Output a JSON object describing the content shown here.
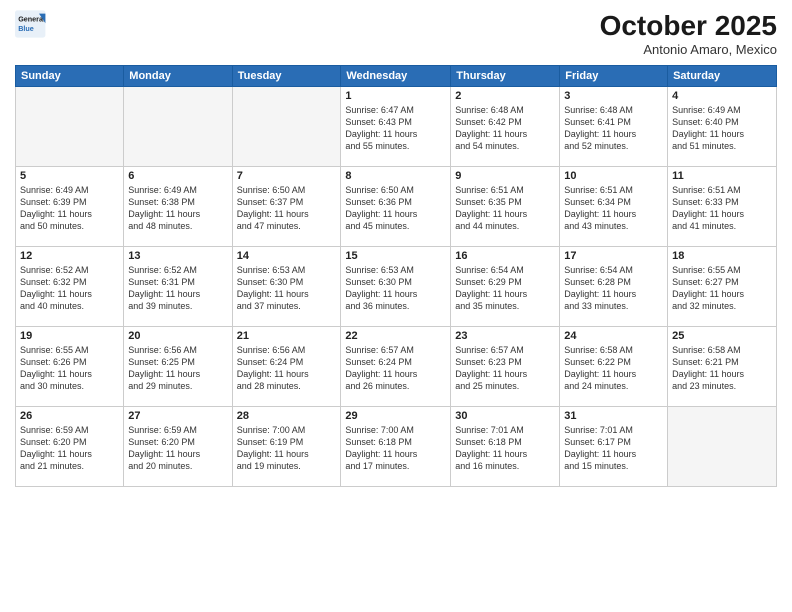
{
  "logo": {
    "line1": "General",
    "line2": "Blue"
  },
  "title": "October 2025",
  "subtitle": "Antonio Amaro, Mexico",
  "days_of_week": [
    "Sunday",
    "Monday",
    "Tuesday",
    "Wednesday",
    "Thursday",
    "Friday",
    "Saturday"
  ],
  "weeks": [
    [
      {
        "day": "",
        "text": ""
      },
      {
        "day": "",
        "text": ""
      },
      {
        "day": "",
        "text": ""
      },
      {
        "day": "1",
        "text": "Sunrise: 6:47 AM\nSunset: 6:43 PM\nDaylight: 11 hours\nand 55 minutes."
      },
      {
        "day": "2",
        "text": "Sunrise: 6:48 AM\nSunset: 6:42 PM\nDaylight: 11 hours\nand 54 minutes."
      },
      {
        "day": "3",
        "text": "Sunrise: 6:48 AM\nSunset: 6:41 PM\nDaylight: 11 hours\nand 52 minutes."
      },
      {
        "day": "4",
        "text": "Sunrise: 6:49 AM\nSunset: 6:40 PM\nDaylight: 11 hours\nand 51 minutes."
      }
    ],
    [
      {
        "day": "5",
        "text": "Sunrise: 6:49 AM\nSunset: 6:39 PM\nDaylight: 11 hours\nand 50 minutes."
      },
      {
        "day": "6",
        "text": "Sunrise: 6:49 AM\nSunset: 6:38 PM\nDaylight: 11 hours\nand 48 minutes."
      },
      {
        "day": "7",
        "text": "Sunrise: 6:50 AM\nSunset: 6:37 PM\nDaylight: 11 hours\nand 47 minutes."
      },
      {
        "day": "8",
        "text": "Sunrise: 6:50 AM\nSunset: 6:36 PM\nDaylight: 11 hours\nand 45 minutes."
      },
      {
        "day": "9",
        "text": "Sunrise: 6:51 AM\nSunset: 6:35 PM\nDaylight: 11 hours\nand 44 minutes."
      },
      {
        "day": "10",
        "text": "Sunrise: 6:51 AM\nSunset: 6:34 PM\nDaylight: 11 hours\nand 43 minutes."
      },
      {
        "day": "11",
        "text": "Sunrise: 6:51 AM\nSunset: 6:33 PM\nDaylight: 11 hours\nand 41 minutes."
      }
    ],
    [
      {
        "day": "12",
        "text": "Sunrise: 6:52 AM\nSunset: 6:32 PM\nDaylight: 11 hours\nand 40 minutes."
      },
      {
        "day": "13",
        "text": "Sunrise: 6:52 AM\nSunset: 6:31 PM\nDaylight: 11 hours\nand 39 minutes."
      },
      {
        "day": "14",
        "text": "Sunrise: 6:53 AM\nSunset: 6:30 PM\nDaylight: 11 hours\nand 37 minutes."
      },
      {
        "day": "15",
        "text": "Sunrise: 6:53 AM\nSunset: 6:30 PM\nDaylight: 11 hours\nand 36 minutes."
      },
      {
        "day": "16",
        "text": "Sunrise: 6:54 AM\nSunset: 6:29 PM\nDaylight: 11 hours\nand 35 minutes."
      },
      {
        "day": "17",
        "text": "Sunrise: 6:54 AM\nSunset: 6:28 PM\nDaylight: 11 hours\nand 33 minutes."
      },
      {
        "day": "18",
        "text": "Sunrise: 6:55 AM\nSunset: 6:27 PM\nDaylight: 11 hours\nand 32 minutes."
      }
    ],
    [
      {
        "day": "19",
        "text": "Sunrise: 6:55 AM\nSunset: 6:26 PM\nDaylight: 11 hours\nand 30 minutes."
      },
      {
        "day": "20",
        "text": "Sunrise: 6:56 AM\nSunset: 6:25 PM\nDaylight: 11 hours\nand 29 minutes."
      },
      {
        "day": "21",
        "text": "Sunrise: 6:56 AM\nSunset: 6:24 PM\nDaylight: 11 hours\nand 28 minutes."
      },
      {
        "day": "22",
        "text": "Sunrise: 6:57 AM\nSunset: 6:24 PM\nDaylight: 11 hours\nand 26 minutes."
      },
      {
        "day": "23",
        "text": "Sunrise: 6:57 AM\nSunset: 6:23 PM\nDaylight: 11 hours\nand 25 minutes."
      },
      {
        "day": "24",
        "text": "Sunrise: 6:58 AM\nSunset: 6:22 PM\nDaylight: 11 hours\nand 24 minutes."
      },
      {
        "day": "25",
        "text": "Sunrise: 6:58 AM\nSunset: 6:21 PM\nDaylight: 11 hours\nand 23 minutes."
      }
    ],
    [
      {
        "day": "26",
        "text": "Sunrise: 6:59 AM\nSunset: 6:20 PM\nDaylight: 11 hours\nand 21 minutes."
      },
      {
        "day": "27",
        "text": "Sunrise: 6:59 AM\nSunset: 6:20 PM\nDaylight: 11 hours\nand 20 minutes."
      },
      {
        "day": "28",
        "text": "Sunrise: 7:00 AM\nSunset: 6:19 PM\nDaylight: 11 hours\nand 19 minutes."
      },
      {
        "day": "29",
        "text": "Sunrise: 7:00 AM\nSunset: 6:18 PM\nDaylight: 11 hours\nand 17 minutes."
      },
      {
        "day": "30",
        "text": "Sunrise: 7:01 AM\nSunset: 6:18 PM\nDaylight: 11 hours\nand 16 minutes."
      },
      {
        "day": "31",
        "text": "Sunrise: 7:01 AM\nSunset: 6:17 PM\nDaylight: 11 hours\nand 15 minutes."
      },
      {
        "day": "",
        "text": ""
      }
    ]
  ]
}
